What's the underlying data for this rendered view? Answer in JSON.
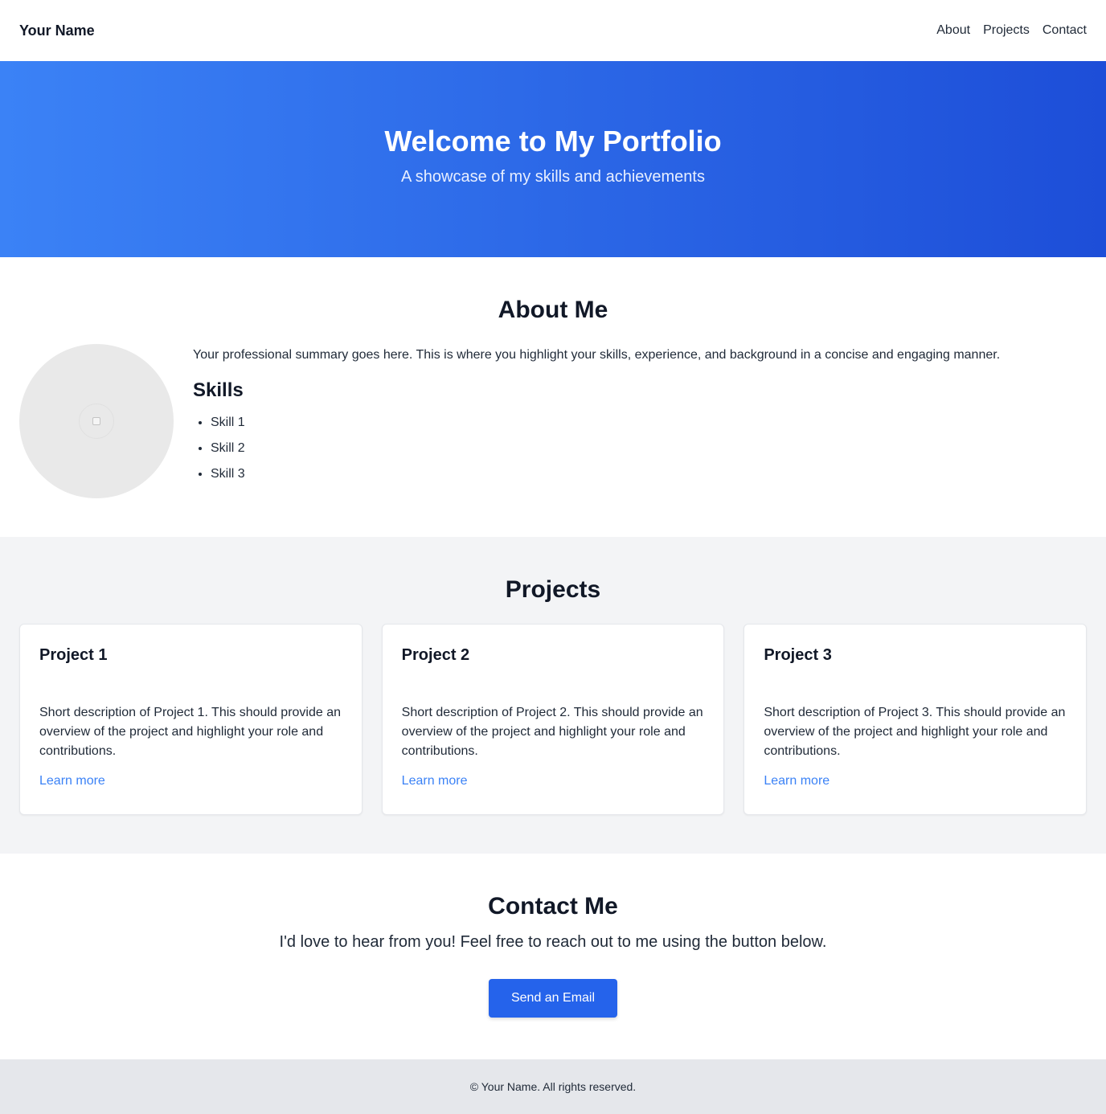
{
  "nav": {
    "brand": "Your Name",
    "links": [
      "About",
      "Projects",
      "Contact"
    ]
  },
  "hero": {
    "title": "Welcome to My Portfolio",
    "subtitle": "A showcase of my skills and achievements"
  },
  "about": {
    "title": "About Me",
    "summary": "Your professional summary goes here. This is where you highlight your skills, experience, and background in a concise and engaging manner.",
    "skills_title": "Skills",
    "skills": [
      "Skill 1",
      "Skill 2",
      "Skill 3"
    ]
  },
  "projects": {
    "title": "Projects",
    "items": [
      {
        "title": "Project 1",
        "description": "Short description of Project 1. This should provide an overview of the project and highlight your role and contributions.",
        "link": "Learn more"
      },
      {
        "title": "Project 2",
        "description": "Short description of Project 2. This should provide an overview of the project and highlight your role and contributions.",
        "link": "Learn more"
      },
      {
        "title": "Project 3",
        "description": "Short description of Project 3. This should provide an overview of the project and highlight your role and contributions.",
        "link": "Learn more"
      }
    ]
  },
  "contact": {
    "title": "Contact Me",
    "text": "I'd love to hear from you! Feel free to reach out to me using the button below.",
    "button": "Send an Email"
  },
  "footer": {
    "text": "© Your Name. All rights reserved."
  },
  "colors": {
    "hero_gradient_start": "#3b82f6",
    "hero_gradient_end": "#1d4ed8",
    "accent": "#2563eb",
    "link": "#3b82f6",
    "projects_bg": "#f3f4f6",
    "footer_bg": "#e5e7eb"
  },
  "icons": {
    "avatar": "profile-image-placeholder-icon"
  }
}
